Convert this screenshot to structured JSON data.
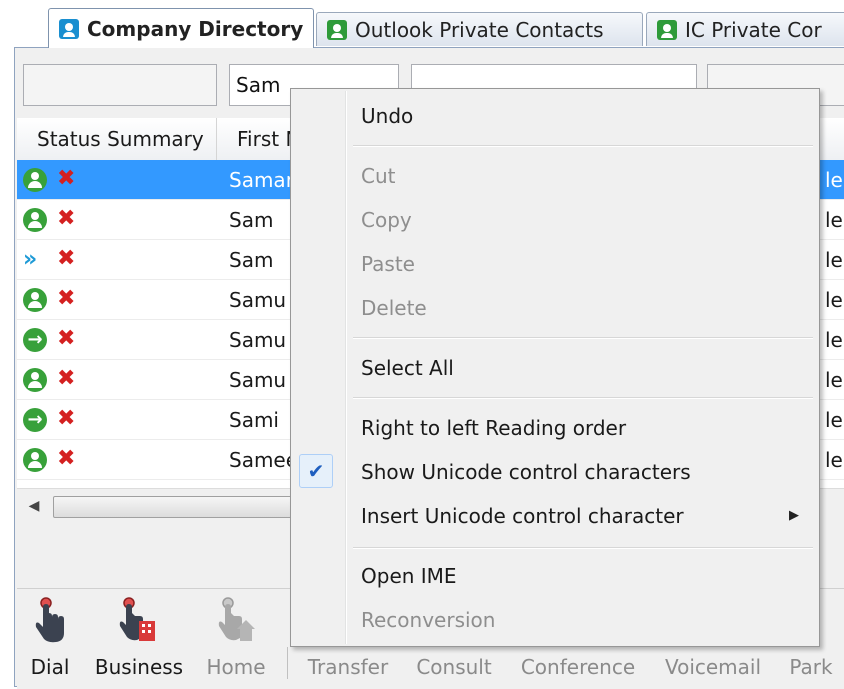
{
  "tabs": [
    {
      "label": "Company Directory",
      "icon": "directory-icon",
      "color": "#1a8fd0"
    },
    {
      "label": "Outlook Private Contacts",
      "icon": "contacts-icon",
      "color": "#2e9b3a"
    },
    {
      "label": "IC Private Cor",
      "icon": "contacts-icon",
      "color": "#2e9b3a"
    }
  ],
  "filter": {
    "first_name_value": "Sam"
  },
  "grid": {
    "columns": [
      "Status Summary",
      "First N"
    ],
    "rows": [
      {
        "status": "available",
        "first": "Samar",
        "right": "le",
        "selected": true
      },
      {
        "status": "available",
        "first": "Sam",
        "right": "le"
      },
      {
        "status": "forwarded",
        "first": "Sam",
        "right": "le,"
      },
      {
        "status": "available",
        "first": "Samu",
        "right": "le"
      },
      {
        "status": "away",
        "first": "Samu",
        "right": "le,"
      },
      {
        "status": "available",
        "first": "Samu",
        "right": "le"
      },
      {
        "status": "away",
        "first": "Sami",
        "right": "le,"
      },
      {
        "status": "available",
        "first": "Samee",
        "right": "le"
      }
    ]
  },
  "actions": [
    {
      "label": "Dial",
      "enabled": true
    },
    {
      "label": "Business",
      "enabled": true
    },
    {
      "label": "Home",
      "enabled": false
    },
    {
      "label": "Transfer",
      "enabled": false
    },
    {
      "label": "Consult",
      "enabled": false
    },
    {
      "label": "Conference",
      "enabled": false
    },
    {
      "label": "Voicemail",
      "enabled": false
    },
    {
      "label": "Park",
      "enabled": false
    }
  ],
  "context_menu": {
    "undo": "Undo",
    "cut": "Cut",
    "copy": "Copy",
    "paste": "Paste",
    "delete": "Delete",
    "select_all": "Select All",
    "rtl": "Right to left Reading order",
    "show_unicode": "Show Unicode control characters",
    "show_unicode_checked": true,
    "insert_unicode": "Insert Unicode control character",
    "open_ime": "Open IME",
    "reconversion": "Reconversion"
  },
  "colors": {
    "selection": "#3399ff",
    "available": "#38a13a",
    "error": "#d42020",
    "forward": "#1e9ad6"
  }
}
